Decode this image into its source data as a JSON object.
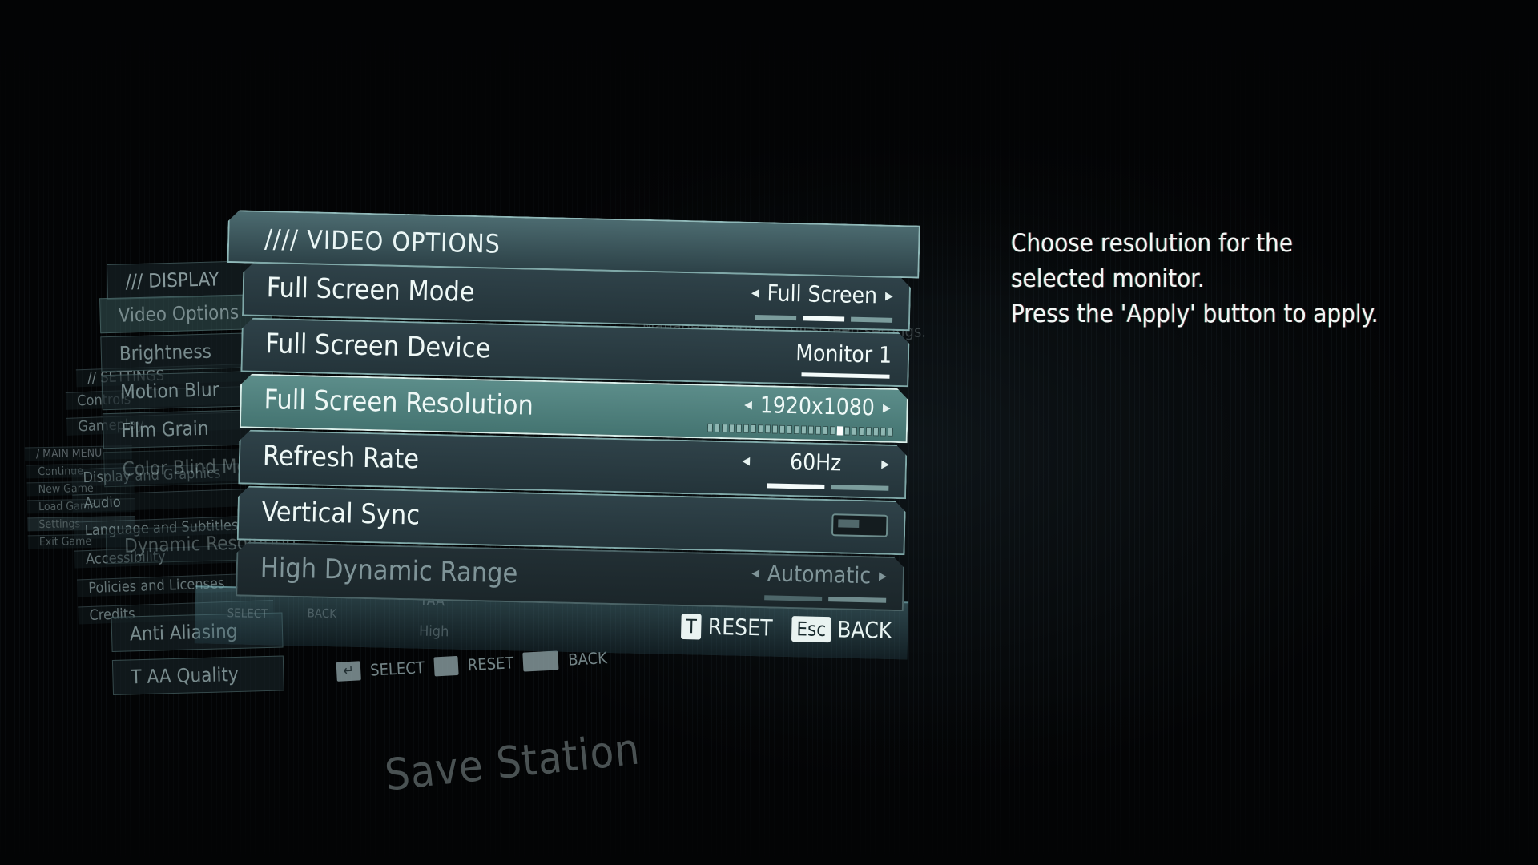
{
  "screen": "Settings - Video Options",
  "background_menus": {
    "main_menu": {
      "header": "/ MAIN MENU",
      "items": [
        "Continue",
        "New Game",
        "Load Game",
        "Settings",
        "Exit Game"
      ],
      "selected": "Settings"
    },
    "settings": {
      "header": "// SETTINGS",
      "items": [
        "Controls",
        "Gameplay",
        "Display and Graphics",
        "Audio",
        "Language and Subtitles",
        "Accessibility",
        "Policies and Licenses",
        "Credits"
      ],
      "selected": "Display and Graphics"
    },
    "display": {
      "header": "/// DISPLAY",
      "items": [
        "Video Options",
        "Brightness",
        "Motion Blur",
        "Film Grain",
        "Color Blind Mode",
        "Dynamic Resolution",
        "Anti Aliasing",
        "T AA Quality"
      ],
      "selected": "Video Options",
      "ghost_values": [
        "TAA",
        "High"
      ]
    },
    "ghost_footer": [
      {
        "key_icon": "enter-key-icon",
        "label": "SELECT"
      },
      {
        "key": "",
        "label": "RESET"
      },
      {
        "key": "",
        "label": "BACK"
      }
    ],
    "ghost_footer_upper": [
      {
        "key_icon": "enter-key-icon",
        "label": "SELECT"
      },
      {
        "key": "",
        "label": "BACK"
      }
    ],
    "ghost_description": "Manage resolution, full screen settings."
  },
  "video_options": {
    "title": "//// VIDEO OPTIONS",
    "rows": [
      {
        "label": "Full Screen Mode",
        "value": "Full Screen",
        "type": "selector",
        "segments": 3,
        "selected_index": 1,
        "enabled": true,
        "selected": false
      },
      {
        "label": "Full Screen Device",
        "value": "Monitor 1",
        "type": "single",
        "enabled": true,
        "selected": false
      },
      {
        "label": "Full Screen Resolution",
        "value": "1920x1080",
        "type": "ticks",
        "segments": 26,
        "selected_index": 18,
        "enabled": true,
        "selected": true
      },
      {
        "label": "Refresh Rate",
        "value": "60Hz",
        "type": "selector",
        "segments": 2,
        "selected_index": 0,
        "enabled": true,
        "selected": false
      },
      {
        "label": "Vertical Sync",
        "value": "Off",
        "type": "toggle",
        "enabled": true,
        "selected": false
      },
      {
        "label": "High Dynamic Range",
        "value": "Automatic",
        "type": "selector",
        "segments": 2,
        "selected_index": 1,
        "enabled": false,
        "selected": false
      }
    ],
    "footer": [
      {
        "key": "T",
        "label": "RESET"
      },
      {
        "key": "Esc",
        "label": "BACK"
      }
    ]
  },
  "help_text": "Choose resolution for the\nselected monitor.\nPress the 'Apply' button to apply.",
  "location_label": "Save Station",
  "colors": {
    "background": "#030405",
    "row": "#2a3b41",
    "row_selected": "#4f807d",
    "border": "#8fb8b8",
    "text": "#eef8f6",
    "text_disabled": "#7f9498"
  }
}
